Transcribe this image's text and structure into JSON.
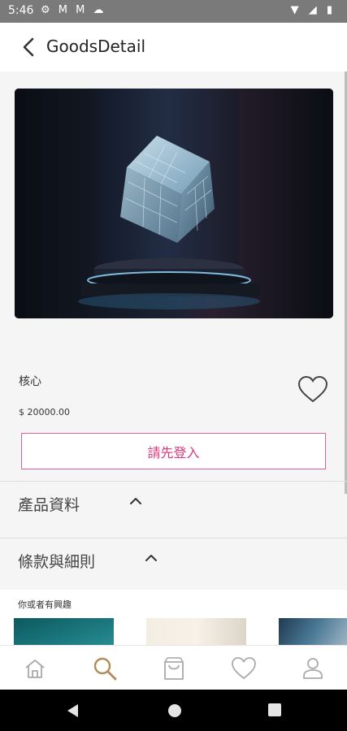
{
  "status_bar": {
    "time": "5:46",
    "left_icons": [
      "gear-icon",
      "gmail-icon",
      "gmail-icon",
      "cloud-icon"
    ],
    "right_icons": [
      "wifi-icon",
      "signal-icon",
      "battery-icon"
    ]
  },
  "app_bar": {
    "title": "GoodsDetail"
  },
  "product": {
    "name": "核心",
    "price": "$ 20000.00",
    "image": "glowing-cube-on-pedestal"
  },
  "actions": {
    "login_label": "請先登入"
  },
  "sections": [
    {
      "label": "產品資料"
    },
    {
      "label": "條款與細則"
    }
  ],
  "recommendations": {
    "title": "你或者有興趣"
  },
  "bottom_nav": {
    "items": [
      "home-icon",
      "search-icon",
      "bag-icon",
      "heart-icon",
      "person-icon"
    ],
    "active": "search-icon",
    "active_color": "#b08d57"
  },
  "colors": {
    "accent_pink": "#d63a7e",
    "status_bar": "#7a7a7a"
  }
}
